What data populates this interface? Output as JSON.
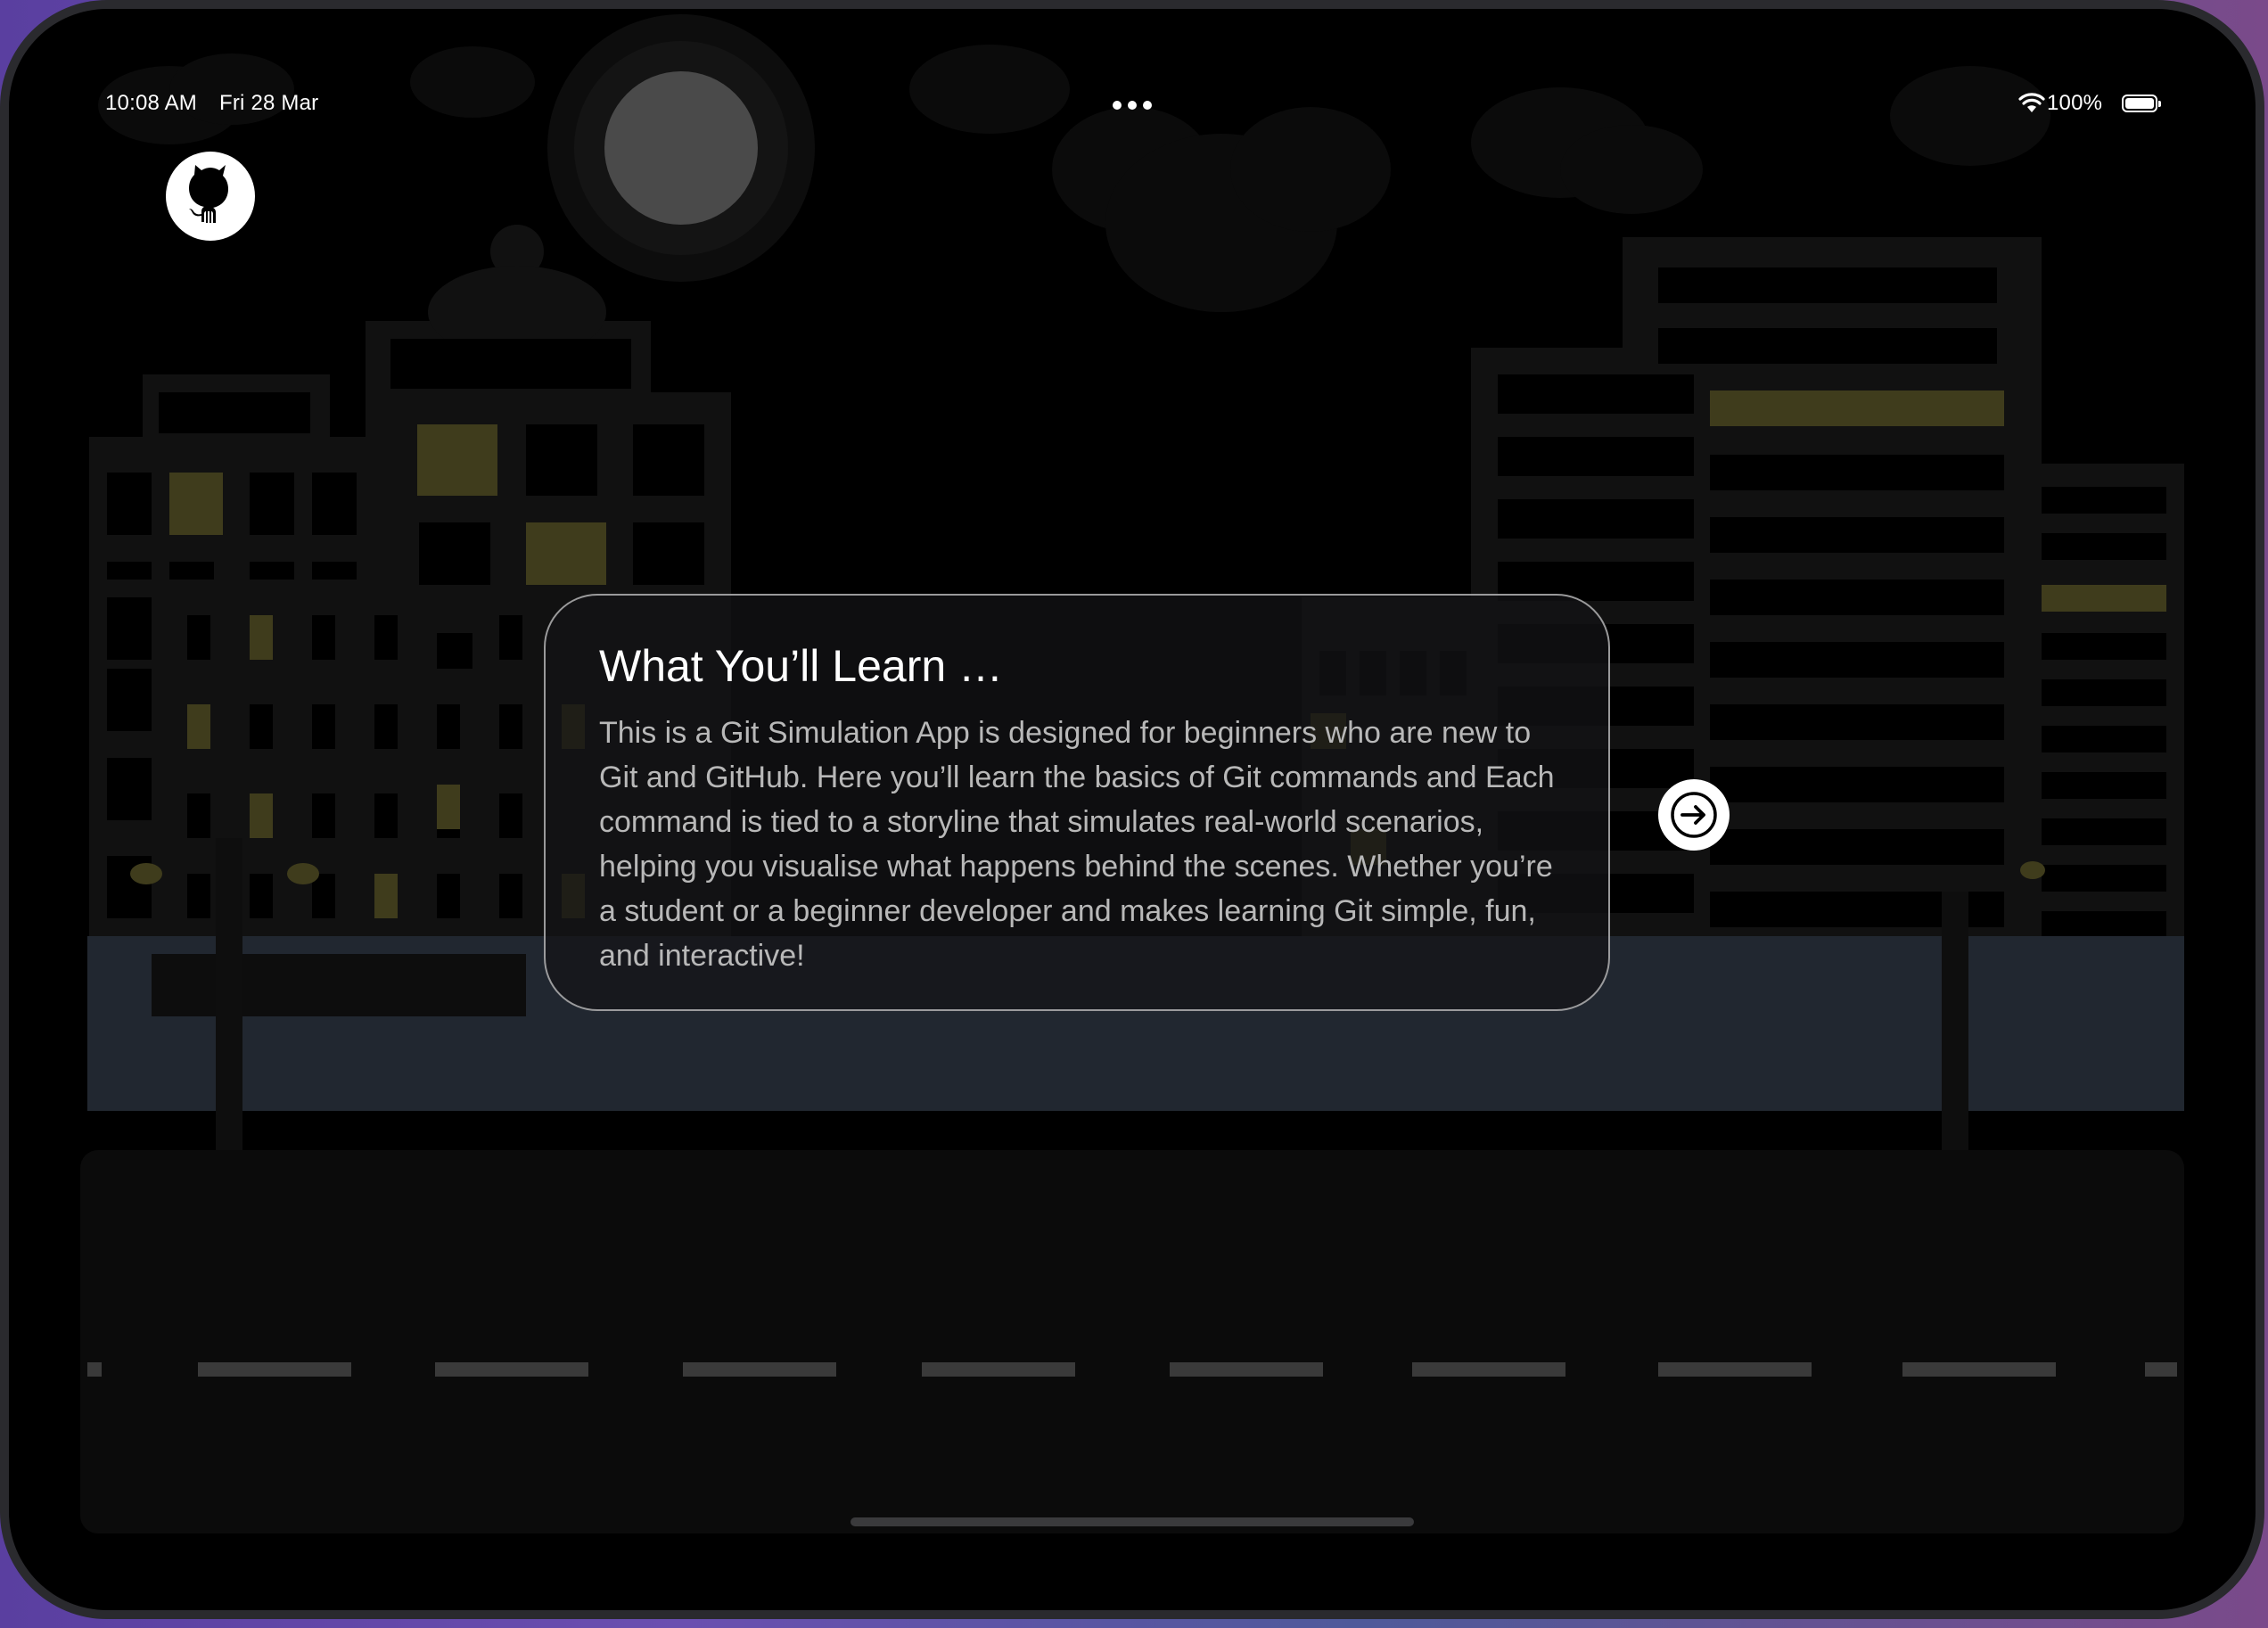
{
  "status_bar": {
    "time": "10:08 AM",
    "date": "Fri 28 Mar",
    "battery_percent": "100%",
    "wifi_icon": "wifi-icon",
    "battery_icon": "battery-icon",
    "multitask_icon": "multitask-dots-icon"
  },
  "header": {
    "github_icon": "github-octocat-icon"
  },
  "info_card": {
    "title": "What You’ll Learn …",
    "body": "This is a Git Simulation App is designed for beginners who are new to Git and GitHub. Here you’ll learn the basics of Git commands and Each command is tied to a storyline that simulates real-world scenarios, helping you visualise what happens behind the scenes. Whether you’re a student or a beginner developer and makes learning Git simple, fun, and interactive!"
  },
  "next_button": {
    "icon": "arrow-right-icon"
  },
  "colors": {
    "background": "#000000",
    "building": "#111111",
    "window_lit": "#3f3c1c",
    "water": "#212730",
    "road": "#0b0b0b",
    "road_marking": "#3a3a3a",
    "moon": "#4a4a4a"
  }
}
